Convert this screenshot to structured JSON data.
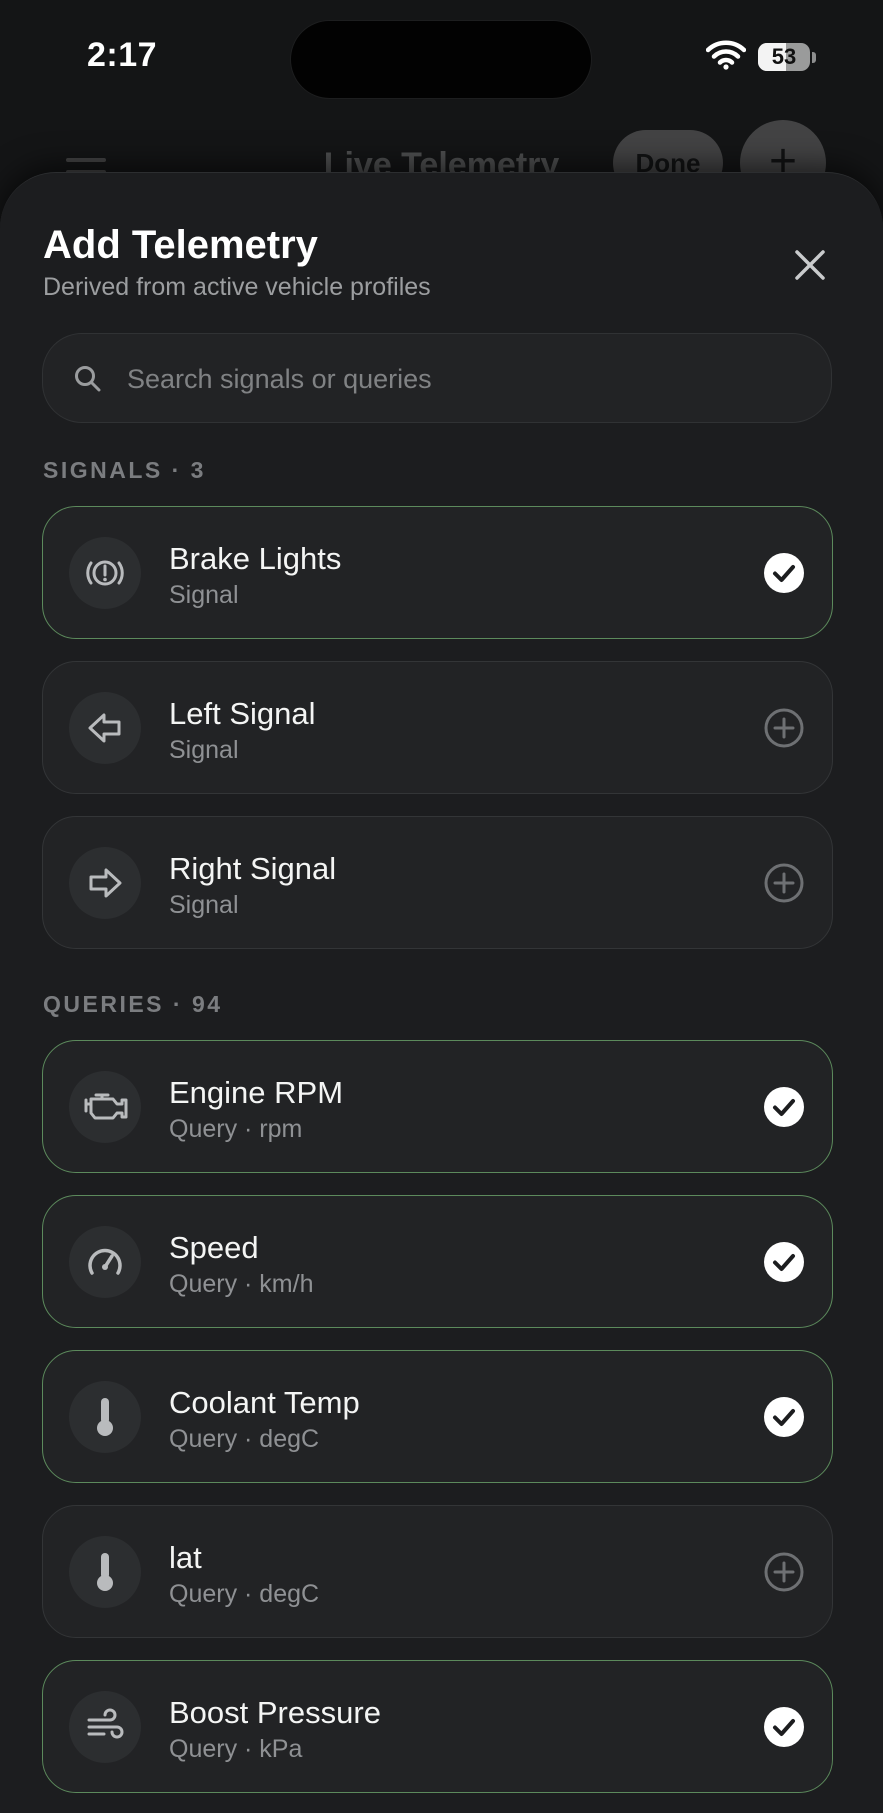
{
  "status_bar": {
    "time": "2:17",
    "battery_level": "53"
  },
  "background_header": {
    "title": "Live Telemetry",
    "done_label": "Done",
    "add_label": "+"
  },
  "sheet": {
    "title": "Add Telemetry",
    "subtitle": "Derived from active vehicle profiles",
    "search_placeholder": "Search signals or queries"
  },
  "signals": {
    "label": "SIGNALS · 3",
    "items": [
      {
        "title": "Brake Lights",
        "subtitle": "Signal",
        "icon": "brake-warning-icon",
        "selected": true
      },
      {
        "title": "Left Signal",
        "subtitle": "Signal",
        "icon": "arrow-left-icon",
        "selected": false
      },
      {
        "title": "Right Signal",
        "subtitle": "Signal",
        "icon": "arrow-right-icon",
        "selected": false
      }
    ]
  },
  "queries": {
    "label": "QUERIES · 94",
    "items": [
      {
        "title": "Engine RPM",
        "subtitle": "Query · rpm",
        "icon": "engine-icon",
        "selected": true
      },
      {
        "title": "Speed",
        "subtitle": "Query · km/h",
        "icon": "speedometer-icon",
        "selected": true
      },
      {
        "title": "Coolant Temp",
        "subtitle": "Query · degC",
        "icon": "thermometer-icon",
        "selected": true
      },
      {
        "title": "lat",
        "subtitle": "Query · degC",
        "icon": "thermometer-icon",
        "selected": false
      },
      {
        "title": "Boost Pressure",
        "subtitle": "Query · kPa",
        "icon": "wind-icon",
        "selected": true
      }
    ]
  },
  "colors": {
    "accent_border": "#5c8a5c",
    "sheet_bg": "#1c1d1f",
    "row_bg": "#222325"
  }
}
